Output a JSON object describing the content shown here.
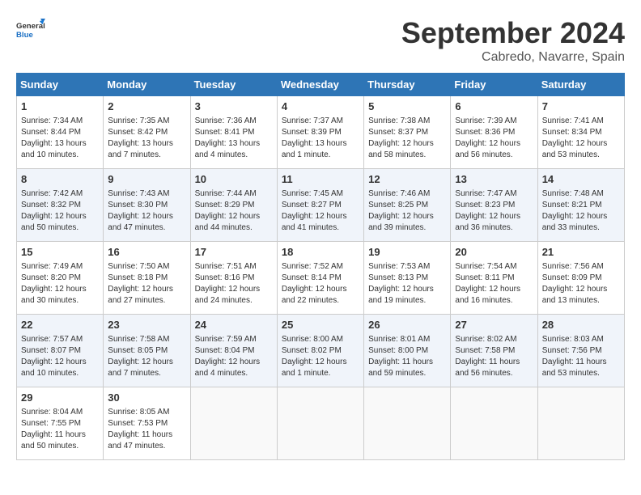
{
  "logo": {
    "line1": "General",
    "line2": "Blue"
  },
  "title": "September 2024",
  "subtitle": "Cabredo, Navarre, Spain",
  "headers": [
    "Sunday",
    "Monday",
    "Tuesday",
    "Wednesday",
    "Thursday",
    "Friday",
    "Saturday"
  ],
  "weeks": [
    [
      {
        "day": "1",
        "info": "Sunrise: 7:34 AM\nSunset: 8:44 PM\nDaylight: 13 hours and 10 minutes."
      },
      {
        "day": "2",
        "info": "Sunrise: 7:35 AM\nSunset: 8:42 PM\nDaylight: 13 hours and 7 minutes."
      },
      {
        "day": "3",
        "info": "Sunrise: 7:36 AM\nSunset: 8:41 PM\nDaylight: 13 hours and 4 minutes."
      },
      {
        "day": "4",
        "info": "Sunrise: 7:37 AM\nSunset: 8:39 PM\nDaylight: 13 hours and 1 minute."
      },
      {
        "day": "5",
        "info": "Sunrise: 7:38 AM\nSunset: 8:37 PM\nDaylight: 12 hours and 58 minutes."
      },
      {
        "day": "6",
        "info": "Sunrise: 7:39 AM\nSunset: 8:36 PM\nDaylight: 12 hours and 56 minutes."
      },
      {
        "day": "7",
        "info": "Sunrise: 7:41 AM\nSunset: 8:34 PM\nDaylight: 12 hours and 53 minutes."
      }
    ],
    [
      {
        "day": "8",
        "info": "Sunrise: 7:42 AM\nSunset: 8:32 PM\nDaylight: 12 hours and 50 minutes."
      },
      {
        "day": "9",
        "info": "Sunrise: 7:43 AM\nSunset: 8:30 PM\nDaylight: 12 hours and 47 minutes."
      },
      {
        "day": "10",
        "info": "Sunrise: 7:44 AM\nSunset: 8:29 PM\nDaylight: 12 hours and 44 minutes."
      },
      {
        "day": "11",
        "info": "Sunrise: 7:45 AM\nSunset: 8:27 PM\nDaylight: 12 hours and 41 minutes."
      },
      {
        "day": "12",
        "info": "Sunrise: 7:46 AM\nSunset: 8:25 PM\nDaylight: 12 hours and 39 minutes."
      },
      {
        "day": "13",
        "info": "Sunrise: 7:47 AM\nSunset: 8:23 PM\nDaylight: 12 hours and 36 minutes."
      },
      {
        "day": "14",
        "info": "Sunrise: 7:48 AM\nSunset: 8:21 PM\nDaylight: 12 hours and 33 minutes."
      }
    ],
    [
      {
        "day": "15",
        "info": "Sunrise: 7:49 AM\nSunset: 8:20 PM\nDaylight: 12 hours and 30 minutes."
      },
      {
        "day": "16",
        "info": "Sunrise: 7:50 AM\nSunset: 8:18 PM\nDaylight: 12 hours and 27 minutes."
      },
      {
        "day": "17",
        "info": "Sunrise: 7:51 AM\nSunset: 8:16 PM\nDaylight: 12 hours and 24 minutes."
      },
      {
        "day": "18",
        "info": "Sunrise: 7:52 AM\nSunset: 8:14 PM\nDaylight: 12 hours and 22 minutes."
      },
      {
        "day": "19",
        "info": "Sunrise: 7:53 AM\nSunset: 8:13 PM\nDaylight: 12 hours and 19 minutes."
      },
      {
        "day": "20",
        "info": "Sunrise: 7:54 AM\nSunset: 8:11 PM\nDaylight: 12 hours and 16 minutes."
      },
      {
        "day": "21",
        "info": "Sunrise: 7:56 AM\nSunset: 8:09 PM\nDaylight: 12 hours and 13 minutes."
      }
    ],
    [
      {
        "day": "22",
        "info": "Sunrise: 7:57 AM\nSunset: 8:07 PM\nDaylight: 12 hours and 10 minutes."
      },
      {
        "day": "23",
        "info": "Sunrise: 7:58 AM\nSunset: 8:05 PM\nDaylight: 12 hours and 7 minutes."
      },
      {
        "day": "24",
        "info": "Sunrise: 7:59 AM\nSunset: 8:04 PM\nDaylight: 12 hours and 4 minutes."
      },
      {
        "day": "25",
        "info": "Sunrise: 8:00 AM\nSunset: 8:02 PM\nDaylight: 12 hours and 1 minute."
      },
      {
        "day": "26",
        "info": "Sunrise: 8:01 AM\nSunset: 8:00 PM\nDaylight: 11 hours and 59 minutes."
      },
      {
        "day": "27",
        "info": "Sunrise: 8:02 AM\nSunset: 7:58 PM\nDaylight: 11 hours and 56 minutes."
      },
      {
        "day": "28",
        "info": "Sunrise: 8:03 AM\nSunset: 7:56 PM\nDaylight: 11 hours and 53 minutes."
      }
    ],
    [
      {
        "day": "29",
        "info": "Sunrise: 8:04 AM\nSunset: 7:55 PM\nDaylight: 11 hours and 50 minutes."
      },
      {
        "day": "30",
        "info": "Sunrise: 8:05 AM\nSunset: 7:53 PM\nDaylight: 11 hours and 47 minutes."
      },
      {
        "day": "",
        "info": ""
      },
      {
        "day": "",
        "info": ""
      },
      {
        "day": "",
        "info": ""
      },
      {
        "day": "",
        "info": ""
      },
      {
        "day": "",
        "info": ""
      }
    ]
  ]
}
